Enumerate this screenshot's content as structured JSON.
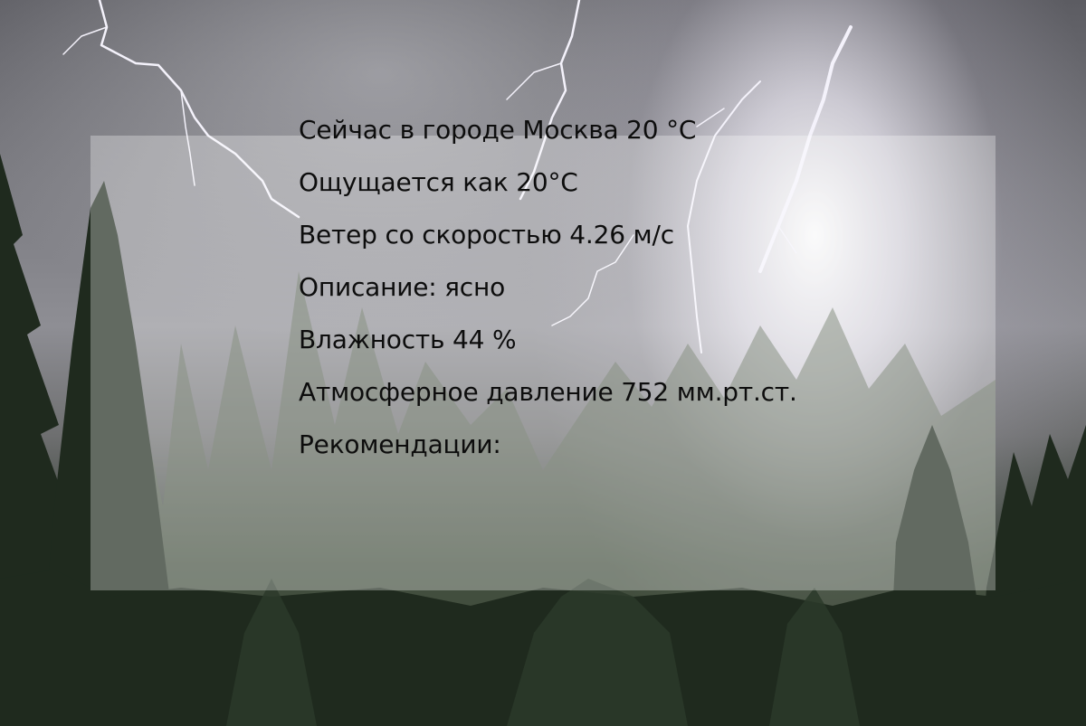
{
  "weather": {
    "lines": [
      "Сейчас в городе Москва 20 °С",
      "Ощущается как 20°С",
      "Ветер со скоростью 4.26 м/с",
      "Описание: ясно",
      "Влажность 44 %",
      "Атмосферное давление 752 мм.рт.ст.",
      "Рекомендации:"
    ]
  },
  "background": {
    "scene": "thunderstorm over pine forest",
    "icon": "lightning-forest-photo"
  },
  "colors": {
    "text": "#0d0d0d",
    "panel": "rgba(255,255,255,0.30)"
  }
}
